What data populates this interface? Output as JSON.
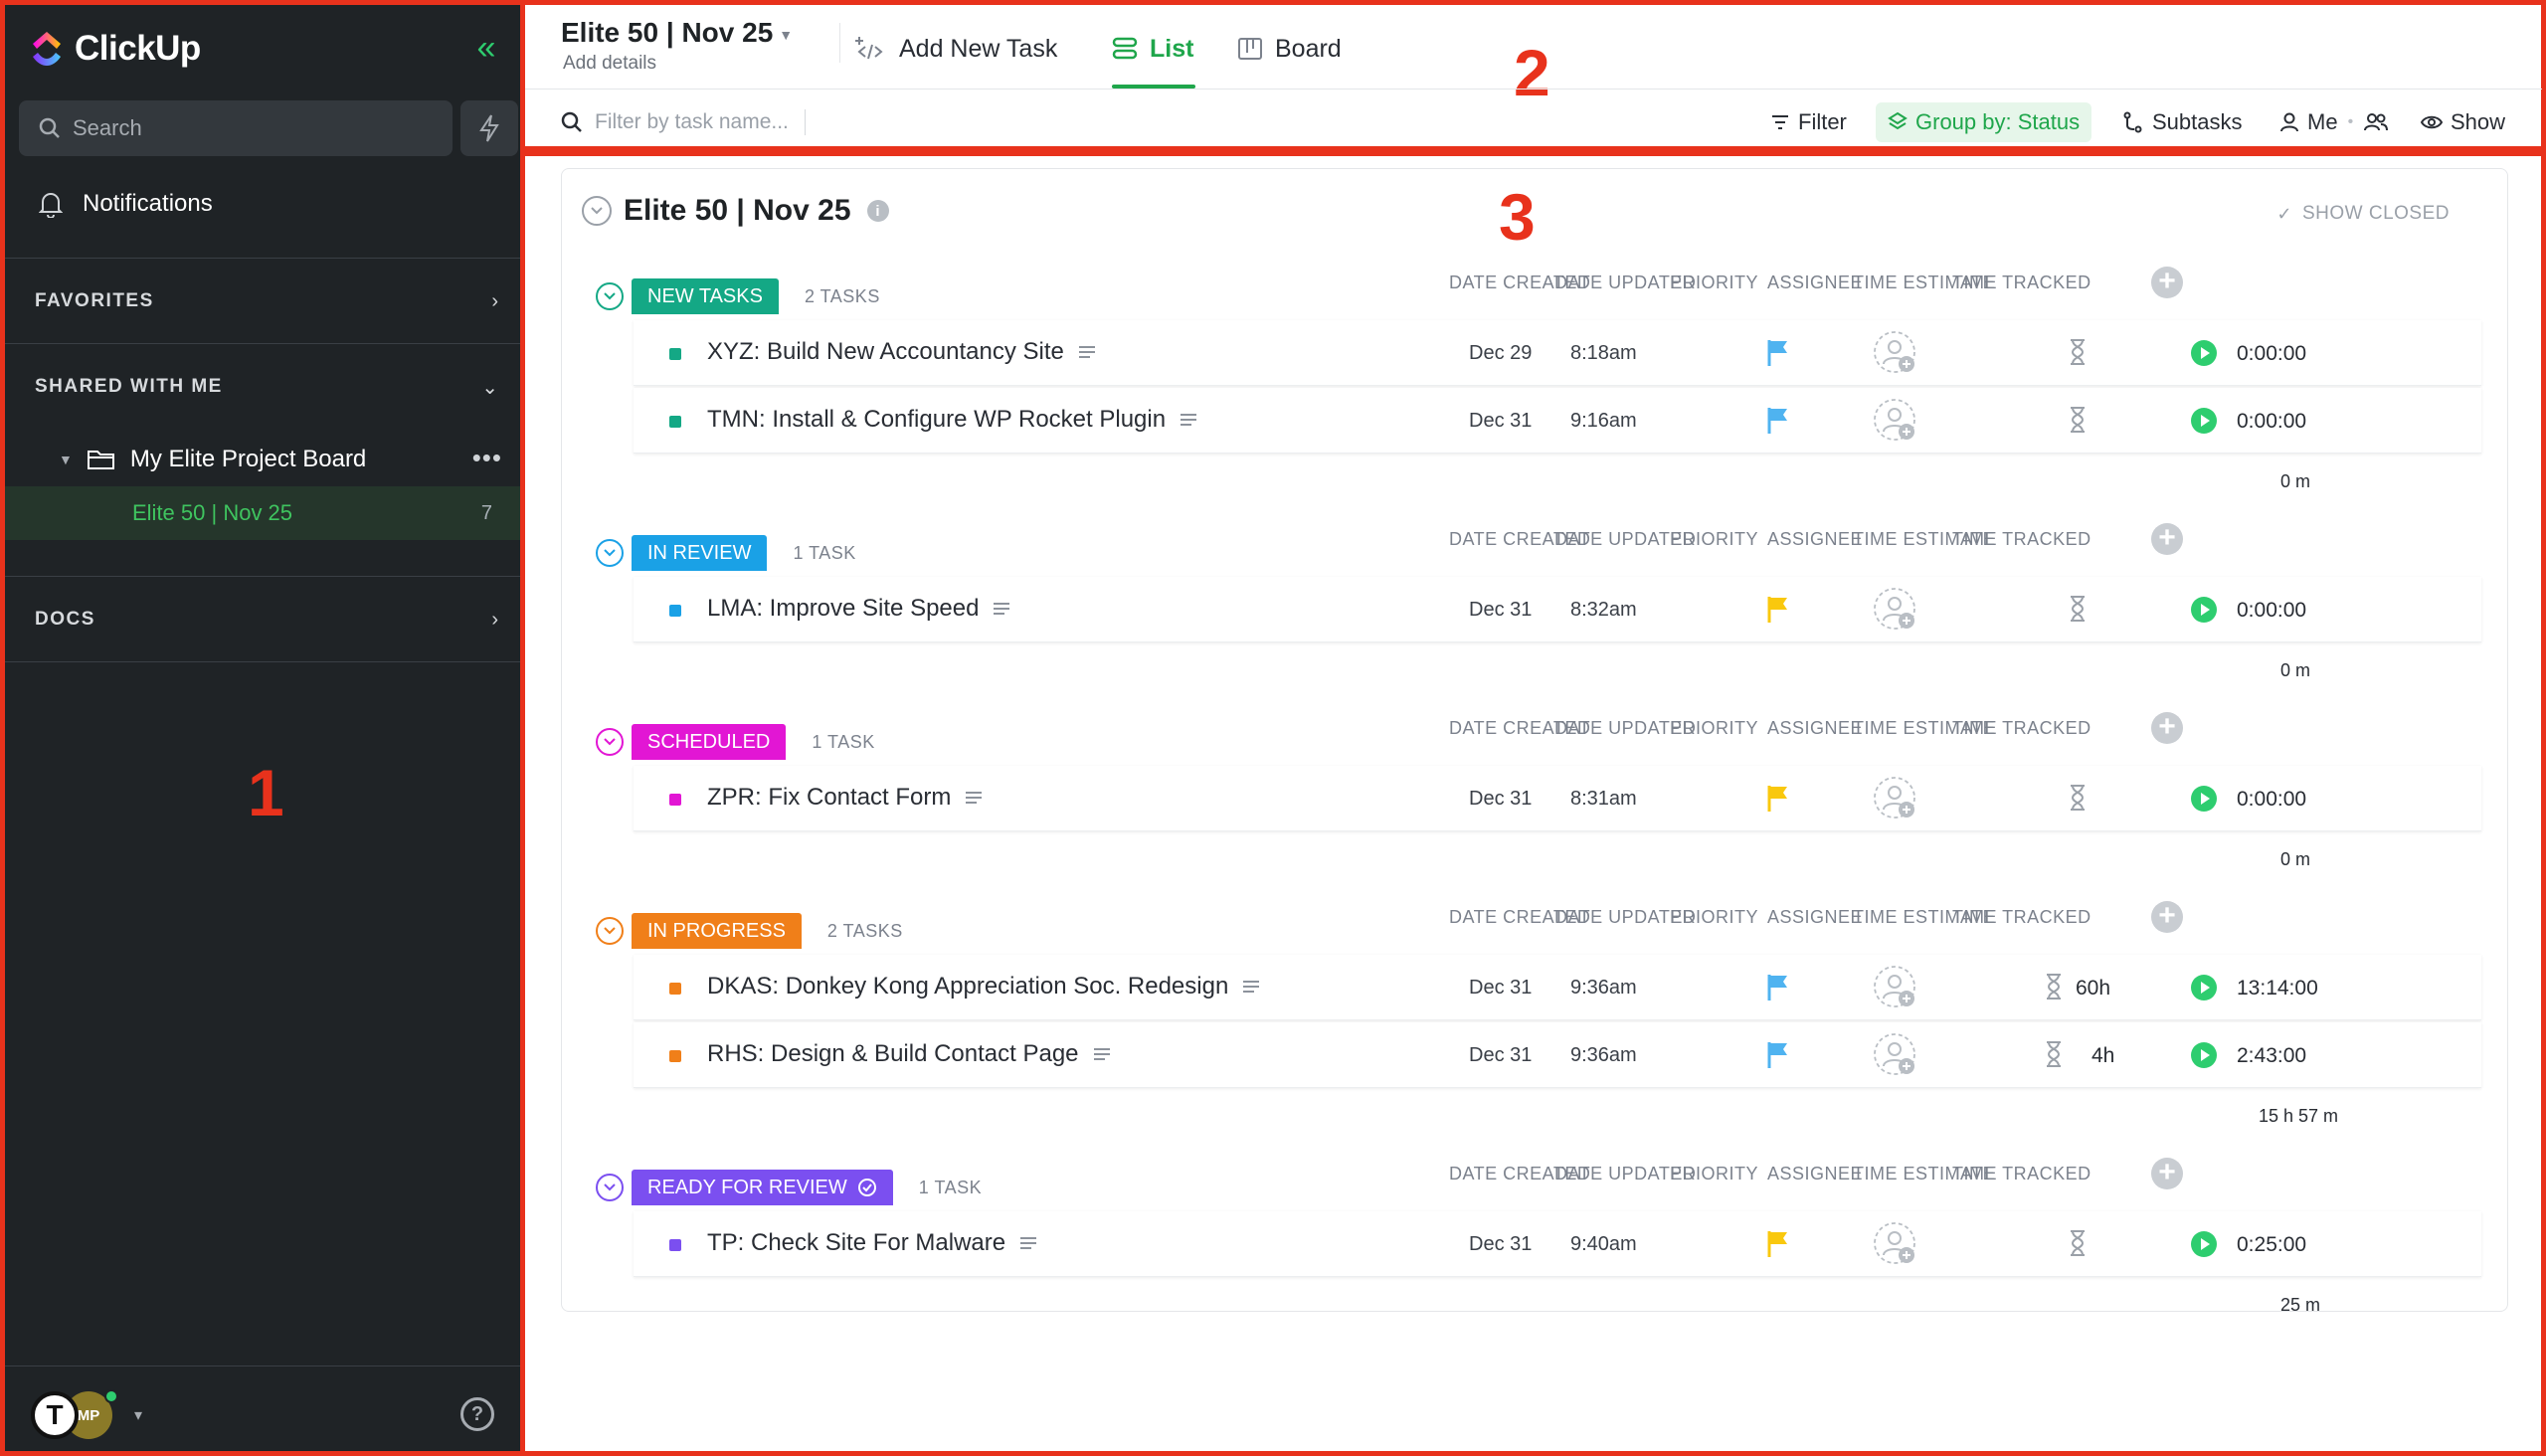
{
  "sidebar": {
    "brand": "ClickUp",
    "search_placeholder": "Search",
    "notifications": "Notifications",
    "favorites": "FAVORITES",
    "shared": "SHARED WITH ME",
    "folder": "My Elite Project Board",
    "active_list": "Elite 50 | Nov 25",
    "active_count": "7",
    "docs": "DOCS",
    "avatar_initial": "T",
    "avatar2_initials": "MP"
  },
  "annotations": {
    "one": "1",
    "two": "2",
    "three": "3"
  },
  "topbar": {
    "title": "Elite 50 | Nov 25",
    "add_details": "Add details",
    "add_task": "Add New Task",
    "list": "List",
    "board": "Board",
    "filter_placeholder": "Filter by task name...",
    "filter": "Filter",
    "group_by": "Group by: Status",
    "subtasks": "Subtasks",
    "me": "Me",
    "show": "Show"
  },
  "main": {
    "title": "Elite 50 | Nov 25",
    "show_closed": "SHOW CLOSED",
    "columns": {
      "date_created": "DATE CREATED",
      "date_updated": "DATE UPDATED",
      "priority": "PRIORITY",
      "assignee": "ASSIGNEE",
      "time_estimate": "TIME ESTIMATE",
      "time_tracked": "TIME TRACKED"
    },
    "groups": [
      {
        "status": "NEW TASKS",
        "count": "2 TASKS",
        "color": "#14a885",
        "total": "0 m",
        "tasks": [
          {
            "name": "XYZ: Build New Accountancy Site",
            "created": "Dec 29",
            "updated": "8:18am",
            "priority_color": "#4fb3f0",
            "estimate": "",
            "tracked": "0:00:00"
          },
          {
            "name": "TMN: Install & Configure WP Rocket Plugin",
            "created": "Dec 31",
            "updated": "9:16am",
            "priority_color": "#4fb3f0",
            "estimate": "",
            "tracked": "0:00:00"
          }
        ]
      },
      {
        "status": "IN REVIEW",
        "count": "1 TASK",
        "color": "#1aa1e6",
        "total": "0 m",
        "tasks": [
          {
            "name": "LMA: Improve Site Speed",
            "created": "Dec 31",
            "updated": "8:32am",
            "priority_color": "#f9c80e",
            "estimate": "",
            "tracked": "0:00:00"
          }
        ]
      },
      {
        "status": "SCHEDULED",
        "count": "1 TASK",
        "color": "#e216d4",
        "total": "0 m",
        "tasks": [
          {
            "name": "ZPR: Fix Contact Form",
            "created": "Dec 31",
            "updated": "8:31am",
            "priority_color": "#f9c80e",
            "estimate": "",
            "tracked": "0:00:00"
          }
        ]
      },
      {
        "status": "IN PROGRESS",
        "count": "2 TASKS",
        "color": "#f07f19",
        "total": "15 h 57 m",
        "tasks": [
          {
            "name": "DKAS: Donkey Kong Appreciation Soc. Redesign",
            "created": "Dec 31",
            "updated": "9:36am",
            "priority_color": "#4fb3f0",
            "estimate": "60h",
            "tracked": "13:14:00"
          },
          {
            "name": "RHS: Design & Build Contact Page",
            "created": "Dec 31",
            "updated": "9:36am",
            "priority_color": "#4fb3f0",
            "estimate": "4h",
            "tracked": "2:43:00"
          }
        ]
      },
      {
        "status": "READY FOR REVIEW",
        "count": "1 TASK",
        "color": "#7b4ff0",
        "total": "25 m",
        "tasks": [
          {
            "name": "TP: Check Site For Malware",
            "created": "Dec 31",
            "updated": "9:40am",
            "priority_color": "#f9c80e",
            "estimate": "",
            "tracked": "0:25:00"
          }
        ]
      }
    ]
  }
}
